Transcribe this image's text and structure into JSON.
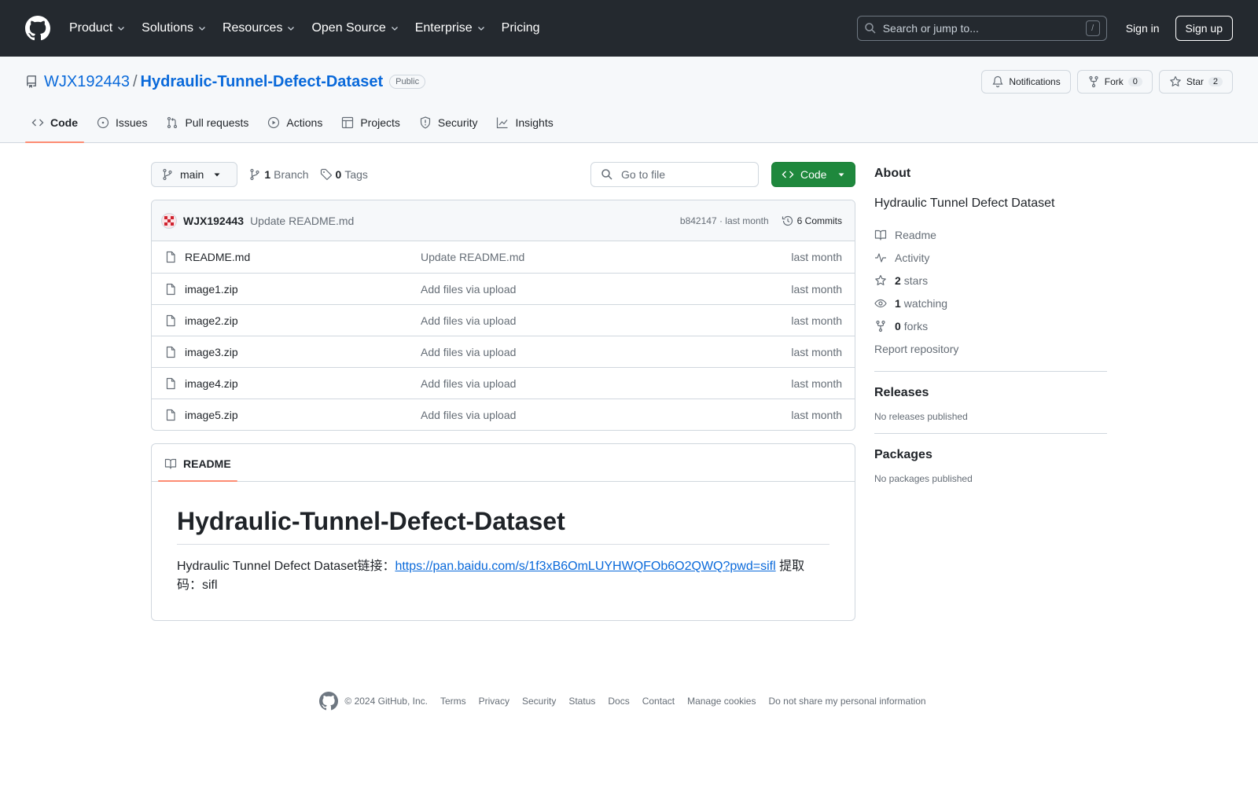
{
  "header": {
    "nav": [
      "Product",
      "Solutions",
      "Resources",
      "Open Source",
      "Enterprise",
      "Pricing"
    ],
    "search_placeholder": "Search or jump to...",
    "search_shortcut": "/",
    "signin": "Sign in",
    "signup": "Sign up"
  },
  "repo": {
    "owner": "WJX192443",
    "separator": "/",
    "name": "Hydraulic-Tunnel-Defect-Dataset",
    "visibility": "Public",
    "notifications_label": "Notifications",
    "fork_label": "Fork",
    "fork_count": "0",
    "star_label": "Star",
    "star_count": "2"
  },
  "tabs": [
    "Code",
    "Issues",
    "Pull requests",
    "Actions",
    "Projects",
    "Security",
    "Insights"
  ],
  "toolbar": {
    "branch": "main",
    "branch_count": "1",
    "branch_label": "Branch",
    "tag_count": "0",
    "tag_label": "Tags",
    "goto_placeholder": "Go to file",
    "code_label": "Code"
  },
  "commit": {
    "author": "WJX192443",
    "message": "Update README.md",
    "meta": "b842147 · last month",
    "commits_label": "6 Commits"
  },
  "files": [
    {
      "name": "README.md",
      "message": "Update README.md",
      "date": "last month"
    },
    {
      "name": "image1.zip",
      "message": "Add files via upload",
      "date": "last month"
    },
    {
      "name": "image2.zip",
      "message": "Add files via upload",
      "date": "last month"
    },
    {
      "name": "image3.zip",
      "message": "Add files via upload",
      "date": "last month"
    },
    {
      "name": "image4.zip",
      "message": "Add files via upload",
      "date": "last month"
    },
    {
      "name": "image5.zip",
      "message": "Add files via upload",
      "date": "last month"
    }
  ],
  "readme": {
    "tab_label": "README",
    "title": "Hydraulic-Tunnel-Defect-Dataset",
    "text_before": "Hydraulic Tunnel Defect Dataset链接：",
    "link": "https://pan.baidu.com/s/1f3xB6OmLUYHWQFOb6O2QWQ?pwd=sifl",
    "text_after": " 提取码：sifl"
  },
  "about": {
    "heading": "About",
    "description": "Hydraulic Tunnel Defect Dataset",
    "readme": "Readme",
    "activity": "Activity",
    "stars_count": "2",
    "stars_label": "stars",
    "watching_count": "1",
    "watching_label": "watching",
    "forks_count": "0",
    "forks_label": "forks",
    "report": "Report repository"
  },
  "releases": {
    "heading": "Releases",
    "text": "No releases published"
  },
  "packages": {
    "heading": "Packages",
    "text": "No packages published"
  },
  "footer": {
    "copyright": "© 2024 GitHub, Inc.",
    "links": [
      "Terms",
      "Privacy",
      "Security",
      "Status",
      "Docs",
      "Contact",
      "Manage cookies",
      "Do not share my personal information"
    ]
  },
  "colors": {
    "header_bg": "#24292f",
    "link": "#0969da",
    "primary_button": "#1f883d",
    "active_tab_underline": "#fd8c73"
  }
}
